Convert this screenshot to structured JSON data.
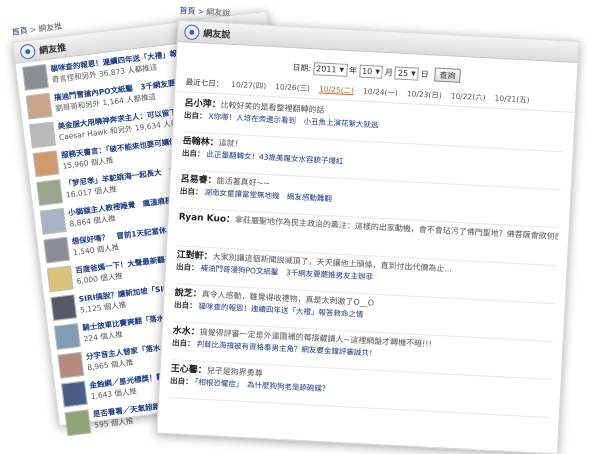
{
  "left_panel": {
    "breadcrumb": {
      "home": "首頁",
      "sep": ">",
      "current": "網友推"
    },
    "title": "網友推",
    "items": [
      {
        "title": "貓咪查的報恩！連續四年送「大禮」報答救命",
        "author": "奇言怪和另外 36,873 人都推這",
        "thumb": "#8a8f96"
      },
      {
        "title": "搞迪鬥雪搶內PO文紙鑿　3千網友要罷推男友",
        "author": "劉哥哥和另外 1,164 人都推這",
        "thumb": "#c8a48a"
      },
      {
        "title": "美金服大用曉神奔求主人：可以留下小貓",
        "author": "Caesar Hawk 和另外 19,634 人都推這",
        "thumb": "#b9b9b9"
      },
      {
        "title": "服務天書言：「破不能來也要可讓你」",
        "author": "15,960 個人推",
        "thumb": "#d19a6e"
      },
      {
        "title": "「梦尼孝」羊駝跳海一起長大　以為自己",
        "author": "16,017 個人推",
        "thumb": "#9aa58c"
      },
      {
        "title": "小貓貓主人教裡睡覺　瘋溫痕模樣超可愛",
        "author": "8,864 個人推",
        "thumb": "#a6b3c4"
      },
      {
        "title": "想保好嗎？　冒前1天記當休息2周全",
        "author": "1,540 個人推",
        "thumb": "#8c8c96"
      },
      {
        "title": "百度爸媽一下！大聲最新聽爭又一種",
        "author": "6,000 個人推",
        "thumb": "#d9c27a"
      },
      {
        "title": "SIRI搞脫？讓新加坡「SIRI」好機",
        "author": "5,125 個人推",
        "thumb": "#555a66"
      },
      {
        "title": "騎士放車比賽爽翻「落水卡」",
        "author": "224 個人推",
        "thumb": "#7f9cb5"
      },
      {
        "title": "分字音主人替家「落水卡」加傷",
        "author": "8,965 個人推",
        "thumb": "#b38a7c"
      },
      {
        "title": "金蝕網／星光標獎！觀音們報",
        "author": "1,643 個人推",
        "thumb": "#4a5c88"
      },
      {
        "title": "是否看著／天氣超新蓋量！網友熱炸",
        "author": "595 個人推",
        "thumb": "#8da474"
      }
    ]
  },
  "right_panel": {
    "breadcrumb": {
      "home": "首頁",
      "sep": ">",
      "current": "網友說"
    },
    "title": "網友說",
    "date_filter": {
      "label": "日期:",
      "year": "2011",
      "year_unit": "年",
      "month": "10",
      "month_unit": "月",
      "day": "25",
      "day_unit": "日",
      "button": "查詢"
    },
    "recent_label": "最近七日：",
    "recent_days": [
      "10/27(四)",
      "10/26(三)",
      "10/25(二)",
      "10/24(一)",
      "10/23(日)",
      "10/22(六)",
      "10/21(五)"
    ],
    "comments": [
      {
        "name": "呂小萍：",
        "text": "比較好笑的是看整裡翻轉的話",
        "from_label": "出自：",
        "source": "X你哪！人培在旁邊示看到　小丑魚上演花絮大就逃"
      },
      {
        "name": "岳翰林：",
        "text": "這就！",
        "from_label": "出自：",
        "source": "此正量翻轉女！43歲美魔女水容貌子爆紅"
      },
      {
        "name": "呂易睿：",
        "text": "能活著真好~~",
        "from_label": "出自：",
        "source": "湖南女童讓當堂無地幾　網友感動難翻"
      },
      {
        "name": "Ryan Kuo：",
        "text": "拿莊嚴聖地作為民主政治的籌注：這樣的出家動機，會不會玷污了佛門聖地？佛菩薩會欲何感想？",
        "from_label": "",
        "source": ""
      },
      {
        "name": "江對軒：",
        "text": "大家別讓這個新聞說滅頂了，天天讓他上頭條，直到付出代價為止...",
        "from_label": "出自：",
        "source": "補油門哥漫狗PO文紙鑿　3千網友要罷推男友主辦菲"
      },
      {
        "name": "說芝：",
        "text": "真令人感動，雖覺得收禮物，真是太刺激了O__O",
        "from_label": "出自：",
        "source": "貓咪查的報恩！連續四年送「大禮」報答救命之情"
      },
      {
        "name": "水水：",
        "text": "搞覺得評審一定是外道園補的莓接藏讀人~這裡網盤才轉機不暗!!!",
        "from_label": "出自：",
        "source": "判貧比海撐被有資格奉男主角？網友要金鐘評審誠共！"
      },
      {
        "name": "王心馨：",
        "text": "兒子是狗界勇尊",
        "from_label": "出自：",
        "source": "「相根恐懼症」　為什麼狗狗老是舔碗碟？"
      }
    ]
  }
}
